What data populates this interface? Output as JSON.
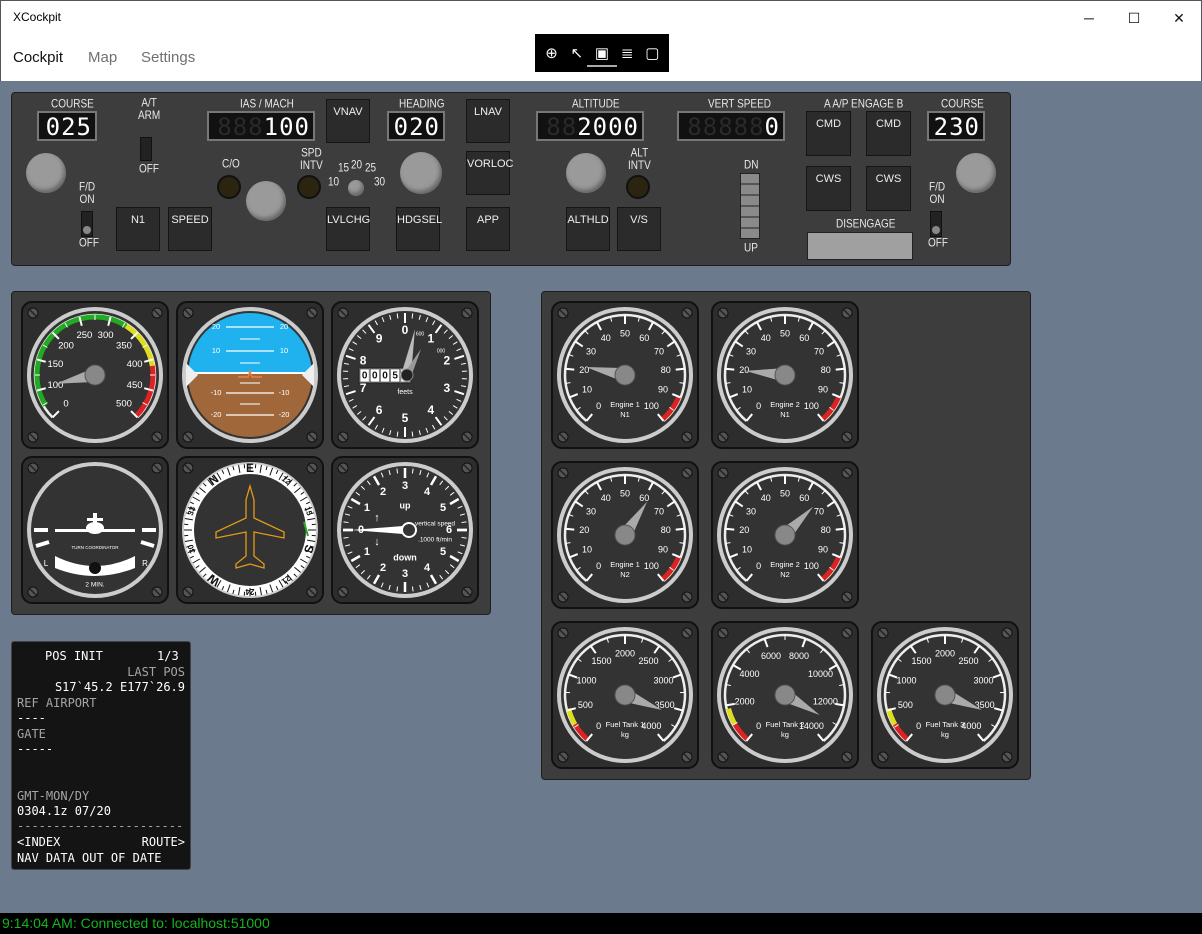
{
  "window": {
    "title": "XCockpit",
    "minimize_icon": "minimize-icon",
    "maximize_icon": "maximize-icon",
    "close_icon": "close-icon"
  },
  "menu": {
    "items": [
      {
        "label": "Cockpit",
        "active": true
      },
      {
        "label": "Map",
        "active": false
      },
      {
        "label": "Settings",
        "active": false
      }
    ],
    "toolbox_icons": [
      "add-element-icon",
      "select-element-icon",
      "frame-icon",
      "inspect-icon",
      "display-icon"
    ]
  },
  "mcp": {
    "course_left": {
      "label": "COURSE",
      "value": "025"
    },
    "at_arm": {
      "label": "A/T\nARM",
      "off": "OFF"
    },
    "fd_left": {
      "on": "F/D\nON",
      "off": "OFF"
    },
    "ias": {
      "label": "IAS / MACH",
      "ghost": "888",
      "value": "100"
    },
    "co": "C/O",
    "spd_intv": "SPD\nINTV",
    "bank": [
      "10",
      "15",
      "20",
      "25",
      "30"
    ],
    "heading": {
      "label": "HEADING",
      "value": "020"
    },
    "altitude": {
      "label": "ALTITUDE",
      "ghost": "88",
      "value": "2000"
    },
    "alt_intv": "ALT\nINTV",
    "vert_speed": {
      "label": "VERT SPEED",
      "ghost": "88888",
      "value": "0"
    },
    "vs_dn": "DN",
    "vs_up": "UP",
    "ap_engage": "A A/P ENGAGE B",
    "course_right": {
      "label": "COURSE",
      "value": "230"
    },
    "fd_right": {
      "on": "F/D\nON",
      "off": "OFF"
    },
    "buttons": {
      "n1": "N1",
      "speed": "SPEED",
      "vnav": "VNAV",
      "lvlchg": "LVLCHG",
      "hdgsel": "HDGSEL",
      "lnav": "LNAV",
      "vorloc": "VORLOC",
      "app": "APP",
      "althld": "ALTHLD",
      "vs": "V/S",
      "cmd_a": "CMD",
      "cmd_b": "CMD",
      "cws_a": "CWS",
      "cws_b": "CWS",
      "disengage": "DISENGAGE"
    }
  },
  "gauges": {
    "airspeed": {
      "ticks": [
        "0",
        "100",
        "150",
        "200",
        "250",
        "300",
        "350",
        "400",
        "450",
        "500"
      ],
      "value": 60
    },
    "attitude": {
      "pitch_labels": [
        "20",
        "10",
        "-10",
        "-20"
      ]
    },
    "altimeter": {
      "digits": [
        "0",
        "0",
        "0",
        "5",
        "1"
      ],
      "unit": "feets",
      "ticks": [
        "0",
        "1",
        "2",
        "3",
        "4",
        "5",
        "6",
        "7",
        "8",
        "9"
      ],
      "small_600": "600",
      "small_000": "000"
    },
    "turn_coordinator": {
      "label": "TURN COORDINATOR",
      "left": "L",
      "right": "R",
      "note": "2 MIN."
    },
    "heading_indicator": {
      "labels": [
        "E",
        "12",
        "15",
        "S",
        "21",
        "24",
        "W",
        "30",
        "33",
        "N"
      ]
    },
    "vsi": {
      "up": "up",
      "down": "down",
      "title": "vertical speed",
      "unit": ".1000 ft/min",
      "ticks": [
        "0",
        "1",
        "2",
        "3",
        "4",
        "5",
        "6"
      ]
    },
    "n1_1": {
      "name": "Engine 1",
      "sub": "N1",
      "ticks": [
        "0",
        "10",
        "20",
        "30",
        "40",
        "50",
        "60",
        "70",
        "80",
        "90",
        "100"
      ],
      "value": 22
    },
    "n1_2": {
      "name": "Engine 2",
      "sub": "N1",
      "ticks": [
        "0",
        "10",
        "20",
        "30",
        "40",
        "50",
        "60",
        "70",
        "80",
        "90",
        "100"
      ],
      "value": 20
    },
    "n2_1": {
      "name": "Engine 1",
      "sub": "N2",
      "ticks": [
        "0",
        "10",
        "20",
        "30",
        "40",
        "50",
        "60",
        "70",
        "80",
        "90",
        "100"
      ],
      "value": 62
    },
    "n2_2": {
      "name": "Engine 2",
      "sub": "N2",
      "ticks": [
        "0",
        "10",
        "20",
        "30",
        "40",
        "50",
        "60",
        "70",
        "80",
        "90",
        "100"
      ],
      "value": 66
    },
    "fuel_1": {
      "name": "Fuel Tank 1",
      "unit": "kg",
      "ticks": [
        "0",
        "500",
        "1000",
        "1500",
        "2000",
        "2500",
        "3000",
        "3500",
        "4000"
      ],
      "value": 3600
    },
    "fuel_2": {
      "name": "Fuel Tank 2",
      "unit": "kg",
      "ticks": [
        "0",
        "2000",
        "4000",
        "6000",
        "8000",
        "10000",
        "12000",
        "14000"
      ],
      "value": 13000
    },
    "fuel_3": {
      "name": "Fuel Tank 3",
      "unit": "kg",
      "ticks": [
        "0",
        "500",
        "1000",
        "1500",
        "2000",
        "2500",
        "3000",
        "3500",
        "4000"
      ],
      "value": 3600
    }
  },
  "cdu": {
    "title": "POS INIT",
    "page": "1/3",
    "last_pos_label": "LAST POS",
    "last_pos": "S17`45.2 E177`26.9",
    "ref_airport_label": "REF AIRPORT",
    "ref_airport": "----",
    "gate_label": "GATE",
    "gate": "-----",
    "gmt_label": "GMT-MON/DY",
    "gmt": "0304.1z 07/20",
    "divider": "------------------------",
    "index": "<INDEX",
    "route": "ROUTE>",
    "message": "NAV DATA OUT OF DATE"
  },
  "status": {
    "text": "9:14:04 AM: Connected to: localhost:51000"
  }
}
